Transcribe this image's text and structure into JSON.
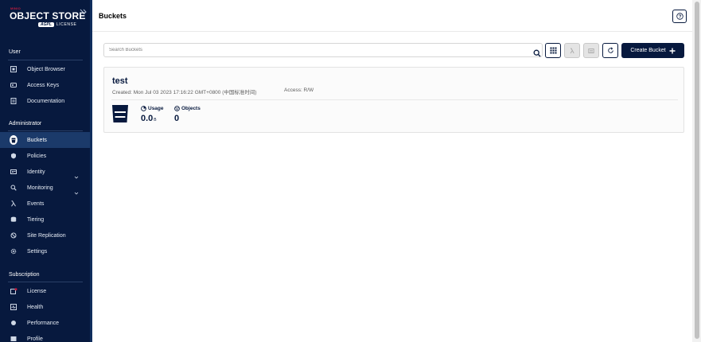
{
  "brand": {
    "maker": "MINIO",
    "title": "OBJECT STORE",
    "edition": "AGPL",
    "license": "LICENSE"
  },
  "sidebar": {
    "sections": {
      "user": "User",
      "administrator": "Administrator",
      "subscription": "Subscription"
    },
    "user_items": [
      {
        "label": "Object Browser",
        "icon": "object-browser-icon"
      },
      {
        "label": "Access Keys",
        "icon": "access-keys-icon"
      },
      {
        "label": "Documentation",
        "icon": "documentation-icon"
      }
    ],
    "admin_items": [
      {
        "label": "Buckets",
        "icon": "buckets-icon",
        "active": true
      },
      {
        "label": "Policies",
        "icon": "policies-icon"
      },
      {
        "label": "Identity",
        "icon": "identity-icon",
        "expandable": true
      },
      {
        "label": "Monitoring",
        "icon": "monitoring-icon",
        "expandable": true
      },
      {
        "label": "Events",
        "icon": "lambda-icon"
      },
      {
        "label": "Tiering",
        "icon": "tiering-icon"
      },
      {
        "label": "Site Replication",
        "icon": "site-replication-icon"
      },
      {
        "label": "Settings",
        "icon": "gear-icon"
      }
    ],
    "subscription_items": [
      {
        "label": "License",
        "icon": "license-icon"
      },
      {
        "label": "Health",
        "icon": "health-icon"
      },
      {
        "label": "Performance",
        "icon": "performance-icon"
      },
      {
        "label": "Profile",
        "icon": "profile-icon"
      }
    ]
  },
  "header": {
    "title": "Buckets"
  },
  "toolbar": {
    "search_placeholder": "Search Buckets",
    "create_label": "Create Bucket"
  },
  "bucket": {
    "name": "test",
    "created": "Created: Mon Jul 03 2023 17:16:22 GMT+0800 (中国标准时间)",
    "access": "Access: R/W",
    "usage_label": "Usage",
    "usage_value": "0.0",
    "usage_unit": "B",
    "objects_label": "Objects",
    "objects_value": "0"
  },
  "colors": {
    "sidebar_bg": "#07193e",
    "accent": "#07193e",
    "active_item": "#1b3a6a",
    "brand_red": "#c51c3f"
  }
}
